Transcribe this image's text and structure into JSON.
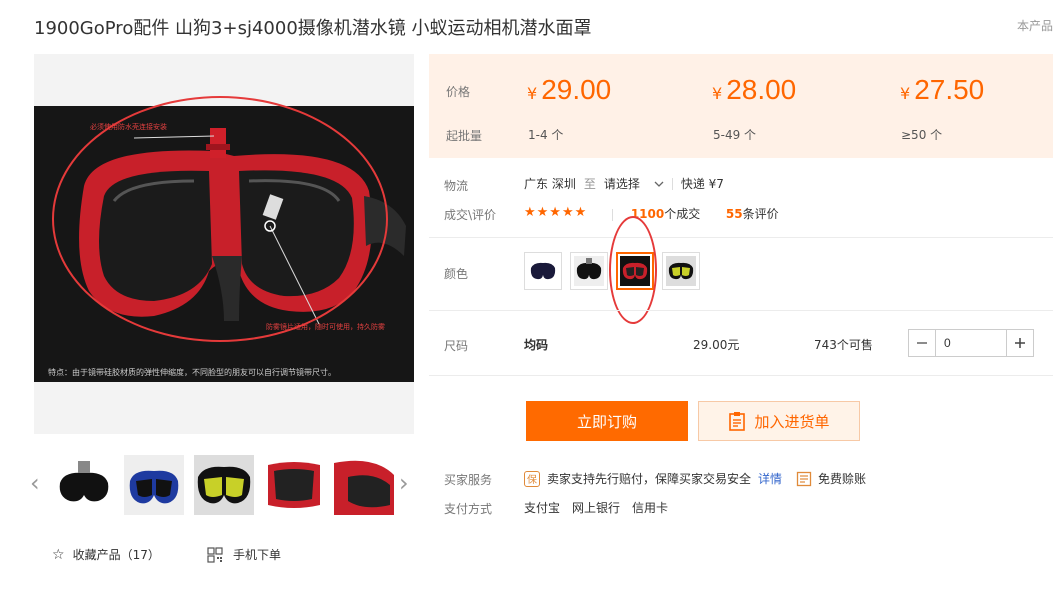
{
  "product": {
    "title": "1900GoPro配件 山狗3+sj4000摄像机潜水镜 小蚁运动相机潜水面罩",
    "this_product_label": "本产品"
  },
  "gallery": {
    "image_caption": "特点：由于镜带硅胶材质的弹性伸缩度，不同脸型的朋友可以自行调节镜带尺寸。",
    "note_top": "必须使用防水壳连接安装",
    "note_bottom": "防雾镜片适用，随时可使用，持久防雾",
    "prev_icon": "‹",
    "next_icon": "›"
  },
  "actions_left": {
    "favorite_label": "收藏产品（17）",
    "phone_order_label": "手机下单"
  },
  "pricing": {
    "price_label": "价格",
    "moq_label": "起批量",
    "currency": "¥",
    "tiers": [
      {
        "price": "29.00",
        "range": "1-4 个"
      },
      {
        "price": "28.00",
        "range": "5-49 个"
      },
      {
        "price": "27.50",
        "range": "≥50 个"
      }
    ]
  },
  "logistics": {
    "label": "物流",
    "origin": "广东 深圳",
    "to": "至",
    "destination": "请选择",
    "shipping": "快递 ¥7"
  },
  "transactions": {
    "label": "成交\\评价",
    "stars": "★★★★★",
    "deals_count": "1100",
    "deals_suffix": "个成交",
    "reviews_count": "55",
    "reviews_suffix": "条评价"
  },
  "color": {
    "label": "颜色"
  },
  "size": {
    "label": "尺码",
    "value": "均码",
    "price": "29.00元",
    "stock": "743个可售",
    "quantity": "0"
  },
  "buttons": {
    "buy_now": "立即订购",
    "add_to_cart": "加入进货单"
  },
  "service": {
    "label": "买家服务",
    "protect_badge": "保",
    "protect_text": "卖家支持先行赔付，保障买家交易安全",
    "details_link": "详情",
    "free_account_text": "免费赊账"
  },
  "payment": {
    "label": "支付方式",
    "methods": [
      "支付宝",
      "网上银行",
      "信用卡"
    ]
  },
  "colors": {
    "accent": "#ff6600",
    "price_bg": "#fff1e7",
    "annotation": "#e53a3a"
  }
}
